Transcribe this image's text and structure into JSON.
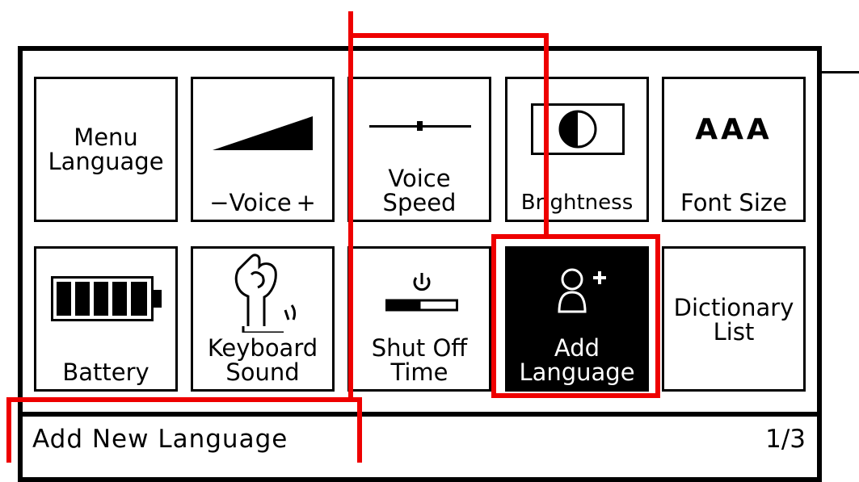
{
  "settings_menu": {
    "tiles": [
      {
        "label_line1": "Menu",
        "label_line2": "Language"
      },
      {
        "label": "−Voice +"
      },
      {
        "label_line1": "Voice",
        "label_line2": "Speed"
      },
      {
        "label": "Brightness"
      },
      {
        "icon_text": "AAA",
        "label": "Font Size"
      },
      {
        "label": "Battery"
      },
      {
        "label_line1": "Keyboard",
        "label_line2": "Sound"
      },
      {
        "label_line1": "Shut Off",
        "label_line2": "Time"
      },
      {
        "label_line1": "Add",
        "label_line2": "Language",
        "selected": true
      },
      {
        "label_line1": "Dictionary",
        "label_line2": "List"
      }
    ],
    "icons": [
      "volume-ramp-icon",
      "speed-slider-icon",
      "contrast-icon",
      "font-size-icon",
      "battery-full-icon",
      "keyboard-touch-icon",
      "power-timer-icon",
      "add-user-icon"
    ]
  },
  "status_bar": {
    "title": "Add New Language",
    "page": "1/3"
  },
  "colors": {
    "callout": "#ee0000",
    "selected_bg": "#000000",
    "screen_bg": "#ffffff"
  }
}
